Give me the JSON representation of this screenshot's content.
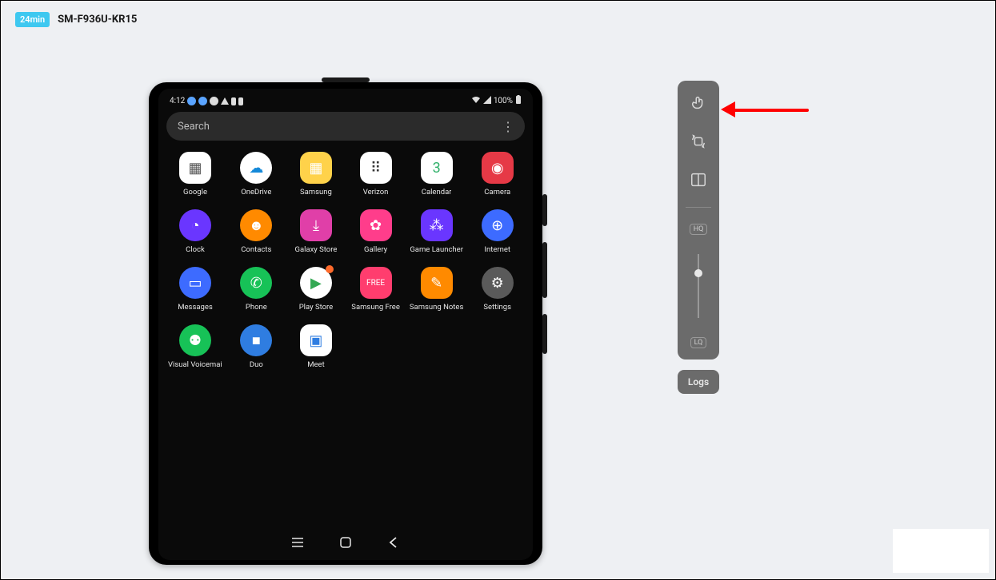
{
  "header": {
    "session_time": "24min",
    "device_name": "SM-F936U-KR15"
  },
  "phone": {
    "status": {
      "time": "4:12",
      "battery_text": "100%"
    },
    "search_placeholder": "Search",
    "apps": [
      {
        "label": "Google",
        "bg": "#ffffff",
        "glyph": "▦",
        "circle": false,
        "fg": "#555"
      },
      {
        "label": "OneDrive",
        "bg": "#ffffff",
        "glyph": "☁",
        "circle": true,
        "fg": "#1488d8"
      },
      {
        "label": "Samsung",
        "bg": "#ffd24a",
        "glyph": "▦",
        "circle": false,
        "fg": "#fff"
      },
      {
        "label": "Verizon",
        "bg": "#ffffff",
        "glyph": "⠿",
        "circle": false,
        "fg": "#333"
      },
      {
        "label": "Calendar",
        "bg": "#ffffff",
        "glyph": "3",
        "circle": false,
        "fg": "#30b06a"
      },
      {
        "label": "Camera",
        "bg": "#e63946",
        "glyph": "◉",
        "circle": false,
        "fg": "#fff"
      },
      {
        "label": "Clock",
        "bg": "#6a36ff",
        "glyph": "◔",
        "circle": true,
        "fg": "#fff"
      },
      {
        "label": "Contacts",
        "bg": "#ff8a00",
        "glyph": "☻",
        "circle": true,
        "fg": "#fff"
      },
      {
        "label": "Galaxy Store",
        "bg": "#e03fa8",
        "glyph": "⤓",
        "circle": false,
        "fg": "#fff"
      },
      {
        "label": "Gallery",
        "bg": "#ff3d8b",
        "glyph": "✿",
        "circle": false,
        "fg": "#fff"
      },
      {
        "label": "Game Launcher",
        "bg": "#6a36ff",
        "glyph": "⁂",
        "circle": false,
        "fg": "#fff"
      },
      {
        "label": "Internet",
        "bg": "#3d6bff",
        "glyph": "⊕",
        "circle": true,
        "fg": "#fff"
      },
      {
        "label": "Messages",
        "bg": "#3d6bff",
        "glyph": "▭",
        "circle": true,
        "fg": "#fff"
      },
      {
        "label": "Phone",
        "bg": "#17c257",
        "glyph": "✆",
        "circle": true,
        "fg": "#fff"
      },
      {
        "label": "Play Store",
        "bg": "#ffffff",
        "glyph": "▶",
        "circle": true,
        "fg": "#34a853",
        "notif": true
      },
      {
        "label": "Samsung Free",
        "bg": "#ff3d6e",
        "glyph": "FREE",
        "circle": false,
        "fg": "#fff",
        "small": true
      },
      {
        "label": "Samsung Notes",
        "bg": "#ff8a00",
        "glyph": "✎",
        "circle": false,
        "fg": "#fff"
      },
      {
        "label": "Settings",
        "bg": "#5a5a5a",
        "glyph": "⚙",
        "circle": true,
        "fg": "#fff"
      },
      {
        "label": "Visual Voicemail",
        "bg": "#17c257",
        "glyph": "⚉",
        "circle": true,
        "fg": "#fff"
      },
      {
        "label": "Duo",
        "bg": "#2f7de1",
        "glyph": "■",
        "circle": true,
        "fg": "#fff"
      },
      {
        "label": "Meet",
        "bg": "#ffffff",
        "glyph": "▣",
        "circle": false,
        "fg": "#2f7de1"
      }
    ]
  },
  "toolbar": {
    "hq_label": "HQ",
    "lq_label": "LQ",
    "logs_label": "Logs"
  }
}
